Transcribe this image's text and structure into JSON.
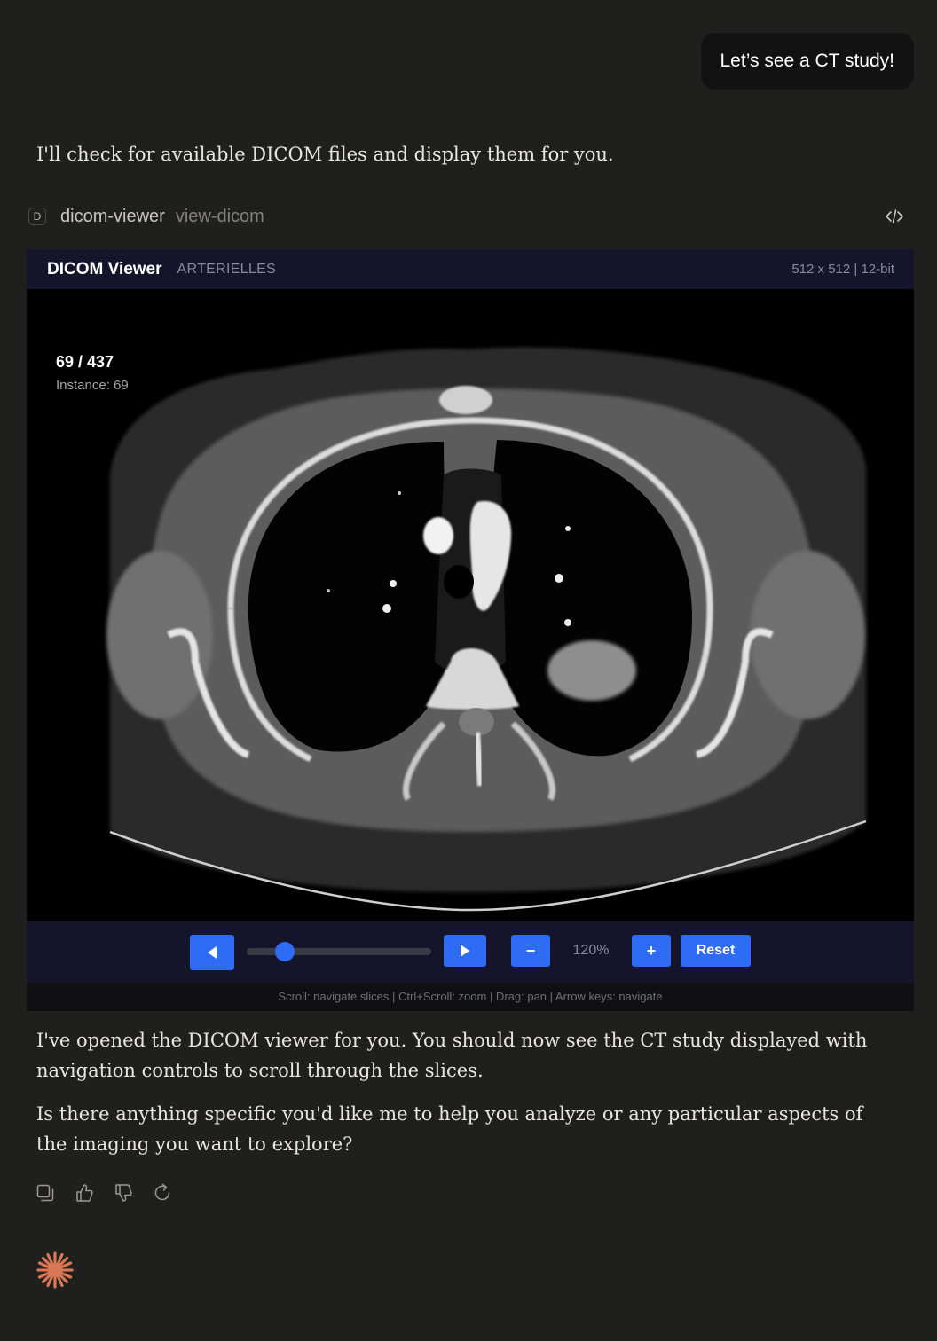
{
  "user_message": "Let’s see a CT study!",
  "assistant": {
    "intro": "I'll check for available DICOM files and display them for you.",
    "reply": [
      "I've opened the DICOM viewer for you. You should now see the CT study displayed with navigation controls to scroll through the slices.",
      "Is there anything specific you'd like me to help you analyze or any particular aspects of the imaging you want to explore?"
    ]
  },
  "tool_call": {
    "badge": "D",
    "server": "dicom-viewer",
    "method": "view-dicom",
    "code_icon": "code-icon"
  },
  "viewer": {
    "title": "DICOM Viewer",
    "series": "ARTERIELLES",
    "dimensions": "512 x 512 | 12-bit",
    "slice_counter": "69 / 437",
    "instance": "Instance: 69",
    "slider": {
      "current": 69,
      "total": 437
    },
    "zoom": "120%",
    "buttons": {
      "prev_icon": "play-left-icon",
      "next_icon": "play-right-icon",
      "zoom_out": "−",
      "zoom_in": "+",
      "reset": "Reset"
    },
    "help": "Scroll: navigate slices | Ctrl+Scroll: zoom | Drag: pan | Arrow keys: navigate",
    "accent_color": "#2f6cf6"
  },
  "actions": [
    "copy-icon",
    "thumbs-up-icon",
    "thumbs-down-icon",
    "retry-icon"
  ],
  "logo_icon": "claude-spark-icon"
}
